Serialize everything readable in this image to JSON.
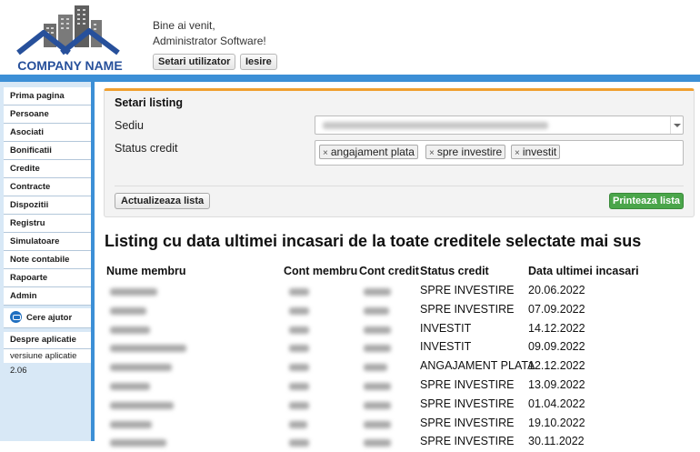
{
  "header": {
    "company_name": "COMPANY NAME",
    "welcome_line1": "Bine ai venit,",
    "welcome_line2": "Administrator Software!",
    "settings_button": "Setari utilizator",
    "logout_button": "Iesire"
  },
  "sidebar": {
    "items": [
      {
        "label": "Prima pagina"
      },
      {
        "label": "Persoane"
      },
      {
        "label": "Asociati"
      },
      {
        "label": "Bonificatii"
      },
      {
        "label": "Credite"
      },
      {
        "label": "Contracte"
      },
      {
        "label": "Dispozitii"
      },
      {
        "label": "Registru"
      },
      {
        "label": "Simulatoare"
      },
      {
        "label": "Note contabile"
      },
      {
        "label": "Rapoarte"
      },
      {
        "label": "Admin"
      }
    ],
    "help": "Cere ajutor",
    "about": "Despre aplicatie",
    "version": "versiune aplicatie 2.06"
  },
  "filters": {
    "title": "Setari listing",
    "sediu_label": "Sediu",
    "status_label": "Status credit",
    "status_tags": [
      "angajament plata",
      "spre investire",
      "investit"
    ],
    "update_button": "Actualizeaza lista",
    "print_button": "Printeaza lista"
  },
  "listing": {
    "heading": "Listing cu data ultimei incasari de la toate creditele selectate mai sus",
    "columns": [
      "Nume membru",
      "Cont membru",
      "Cont credit",
      "Status credit",
      "Data ultimei incasari"
    ],
    "rows": [
      {
        "status": "SPRE INVESTIRE",
        "date": "20.06.2022"
      },
      {
        "status": "SPRE INVESTIRE",
        "date": "07.09.2022"
      },
      {
        "status": "INVESTIT",
        "date": "14.12.2022"
      },
      {
        "status": "INVESTIT",
        "date": "09.09.2022"
      },
      {
        "status": "ANGAJAMENT PLATA",
        "date": "12.12.2022"
      },
      {
        "status": "SPRE INVESTIRE",
        "date": "13.09.2022"
      },
      {
        "status": "SPRE INVESTIRE",
        "date": "01.04.2022"
      },
      {
        "status": "SPRE INVESTIRE",
        "date": "19.10.2022"
      },
      {
        "status": "SPRE INVESTIRE",
        "date": "30.11.2022"
      }
    ]
  },
  "colors": {
    "accent_blue": "#3c8fd6",
    "panel_top_border": "#f0a030",
    "print_button_green": "#4aa54a",
    "logo_blue": "#27509b"
  }
}
